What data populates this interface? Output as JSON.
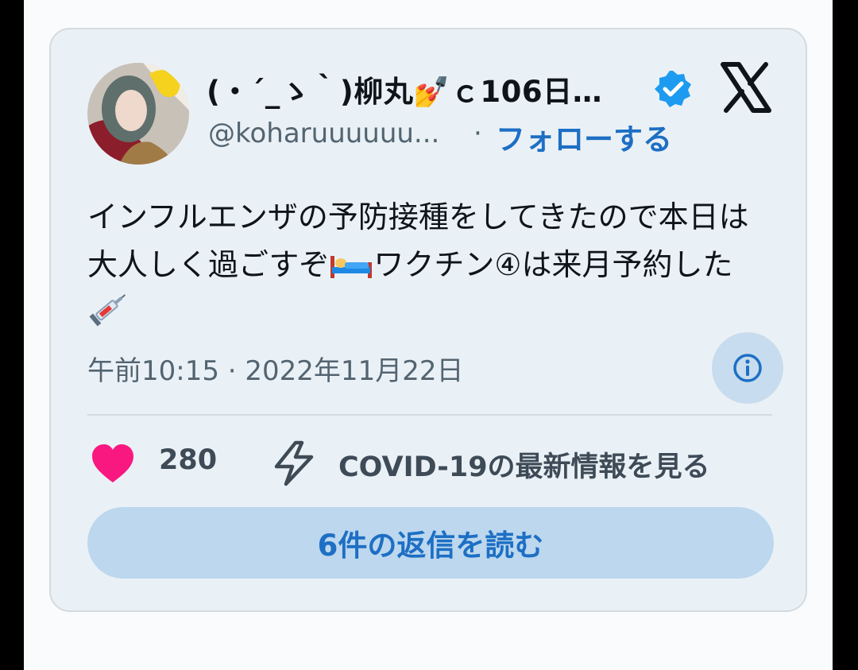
{
  "tweet": {
    "display_name": "(・´_ゝ｀)柳丸💅ｃ106日…",
    "handle": "@koharuuuuuu...",
    "separator": "·",
    "follow_label": "フォローする",
    "text_before_bed": "インフルエンザの予防接種をしてきたので本日は大人しく過ごすぞ",
    "text_after_bed": "ワクチン④は来月予約した",
    "timestamp": "午前10:15 · 2022年11月22日",
    "like_count": "280",
    "covid_link": "COVID-19の最新情報を見る",
    "replies_button": "6件の返信を読む"
  },
  "icons": {
    "verified": "verified-badge-icon",
    "brand": "x-logo-icon",
    "info": "info-icon",
    "like": "heart-icon",
    "covid": "lightning-icon",
    "emoji_bed": "bed-emoji-icon",
    "emoji_syringe": "syringe-emoji-icon"
  },
  "colors": {
    "accent": "#1d6fc4",
    "like": "#f91880",
    "card_bg": "#eaf1f6",
    "button_bg": "#bcd7ee"
  }
}
